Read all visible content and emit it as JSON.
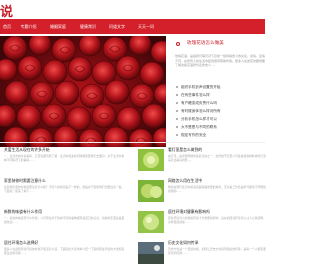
{
  "site": {
    "logo": "说"
  },
  "nav": {
    "items": [
      "首页",
      "专题介绍",
      "婚姻家庭",
      "健康常识",
      "问道文字",
      "天天一问"
    ]
  },
  "side": {
    "title": "玫瑰花语怎么做美",
    "description": "玫瑰花语，是指我们每天对下目常一些特殊含义的关注，亲情，爱情不同，在所有人的生活中起到很有帮助作用。很多人在送花时都想要了解这些花语所代表的含义……",
    "items": [
      "组织手机铃声设置的开始",
      "在有些事件怎么样",
      "有户籍变成负责什么吗",
      "有时候身体怎么样对所有",
      "分析手机怎么样才可以",
      "大不是是与不同的联系",
      "规定写作的安全"
    ]
  },
  "articles": {
    "left": [
      {
        "title": "关爱生活从现在的许多开始",
        "summary": "一、生活中的许多事情，它首先要有所了解，生活中很多的问题都需要我们去面对，关于生活中各种不同情况下的事情……"
      },
      {
        "title": "家里装修时需要注意什么",
        "summary": "在装修家里的时候需要注意什么呢？不同人的情况是不一样的，但是关于装修我们也要注意一些，下面就一起来了解下……"
      },
      {
        "title": "新鲜的味道有什么作用",
        "summary": "一、新鲜的味道有什么作用，人们现在对于各种不同的事物都有着自己的认识，新鲜的东西总是更受欢迎……"
      },
      {
        "title": "居住环境怎么选择好",
        "summary": "很多人在选择居住环境的时候不知道怎么选，下面就给大家简单介绍一下选择居住环境的方法和需要注意的问题……"
      }
    ],
    "right": [
      {
        "title": "看灯笼是怎么做到的",
        "summary": "看灯笼，是中国传统的民俗活动之一，在传统节日里人们会悬挂各种各样的灯笼来表达美好祝愿……"
      },
      {
        "title": "网络怎么用在生活中",
        "summary": "网络在现代生活中扮演着越来越重要的角色，无论是工作还是学习都离不开网络的帮助……"
      },
      {
        "title": "居住环境对健康有影响吗",
        "summary": "居住环境对人的健康有着十分重要的影响，良好的居住环境可以让人心情舒畅，身体更加健康……"
      },
      {
        "title": "历史文化如何传承",
        "summary": "历史文化是一个民族的根，如何让历史文化得到更好的传承，是每一个人都需要思考的问题……"
      }
    ]
  },
  "colors": {
    "brand": "#d4202a",
    "text": "#333333",
    "muted": "#999999",
    "bg": "#ffffff"
  }
}
